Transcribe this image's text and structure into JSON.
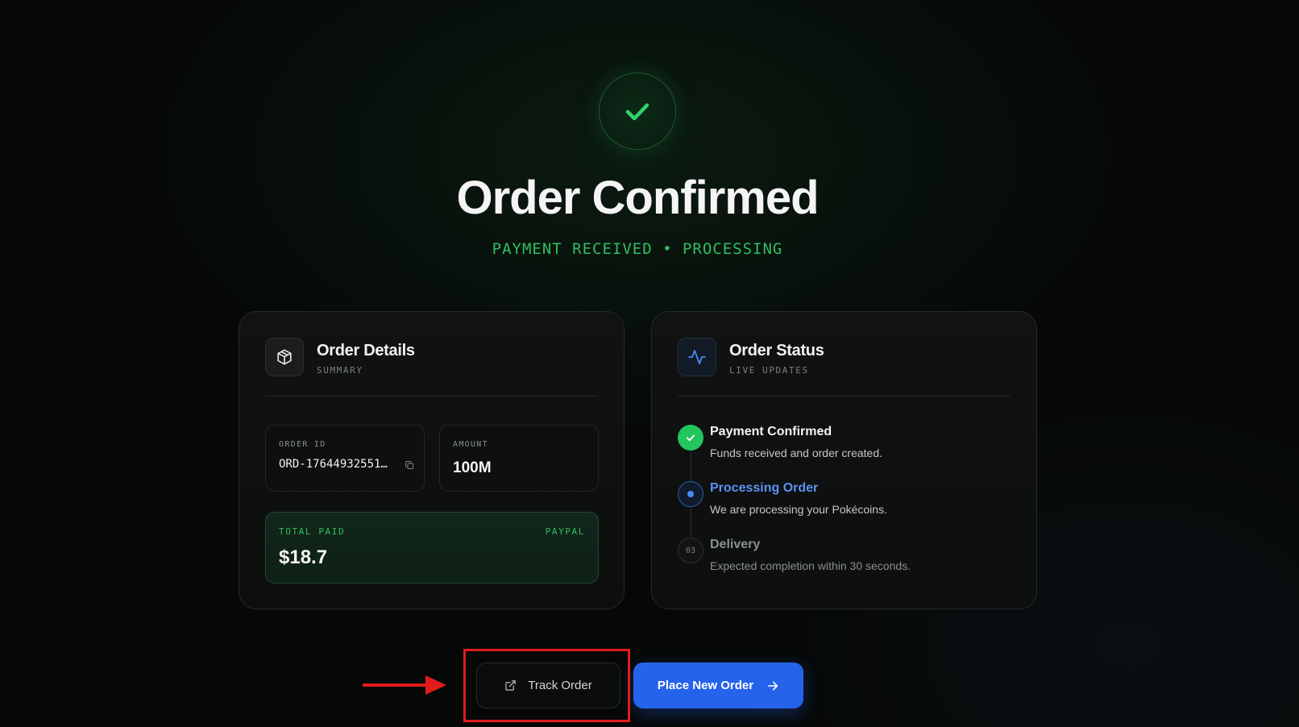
{
  "hero": {
    "title": "Order Confirmed",
    "subtitle": "PAYMENT RECEIVED • PROCESSING",
    "badge_icon": "check-icon"
  },
  "order_details": {
    "title": "Order Details",
    "subtitle": "SUMMARY",
    "icon": "package-icon",
    "order_id_label": "ORDER ID",
    "order_id_value": "ORD-17644932551…",
    "copy_icon": "copy-icon",
    "amount_label": "AMOUNT",
    "amount_value": "100M",
    "total_label": "TOTAL PAID",
    "payment_method": "PAYPAL",
    "total_value": "$18.7"
  },
  "order_status": {
    "title": "Order Status",
    "subtitle": "LIVE UPDATES",
    "icon": "activity-icon",
    "steps": [
      {
        "title": "Payment Confirmed",
        "description": "Funds received and order created.",
        "state": "done"
      },
      {
        "title": "Processing Order",
        "description": "We are processing your Pokécoins.",
        "state": "active"
      },
      {
        "number": "03",
        "title": "Delivery",
        "description": "Expected completion within 30 seconds.",
        "state": "pending"
      }
    ]
  },
  "actions": {
    "track_label": "Track Order",
    "track_icon": "external-link-icon",
    "new_order_label": "Place New Order",
    "new_order_icon": "arrow-right-icon"
  },
  "colors": {
    "accent_green": "#22c55e",
    "accent_blue": "#2563eb",
    "highlight_red": "#e01b1b"
  }
}
